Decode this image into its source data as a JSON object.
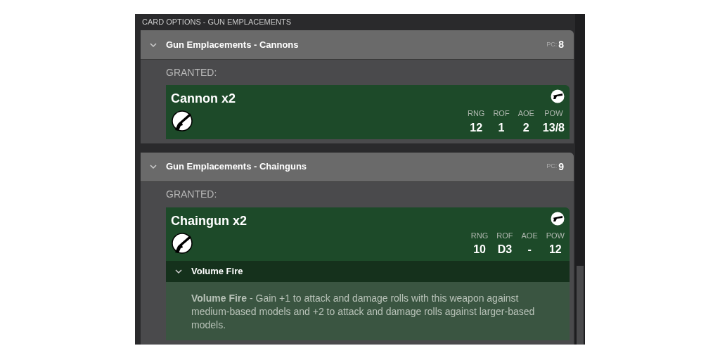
{
  "panel_title": "CARD OPTIONS - GUN EMPLACEMENTS",
  "sections": [
    {
      "title": "Gun Emplacements - Cannons",
      "pc_label": "PC:",
      "pc_value": "8",
      "expanded": true,
      "granted_label": "GRANTED:",
      "weapons": [
        {
          "name": "Cannon x2",
          "stats": [
            {
              "label": "RNG",
              "value": "12"
            },
            {
              "label": "ROF",
              "value": "1"
            },
            {
              "label": "AOE",
              "value": "2"
            },
            {
              "label": "POW",
              "value": "13/8"
            }
          ]
        }
      ]
    },
    {
      "title": "Gun Emplacements - Chainguns",
      "pc_label": "PC:",
      "pc_value": "9",
      "expanded": true,
      "granted_label": "GRANTED:",
      "weapons": [
        {
          "name": "Chaingun x2",
          "stats": [
            {
              "label": "RNG",
              "value": "10"
            },
            {
              "label": "ROF",
              "value": "D3"
            },
            {
              "label": "AOE",
              "value": "-"
            },
            {
              "label": "POW",
              "value": "12"
            }
          ],
          "abilities": [
            {
              "title": "Volume Fire",
              "expanded": true,
              "text": "**Volume Fire** - Gain +1 to attack and damage rolls with this weapon against medium-based models and +2 to attack and damage rolls against larger-based models."
            }
          ]
        }
      ]
    }
  ]
}
